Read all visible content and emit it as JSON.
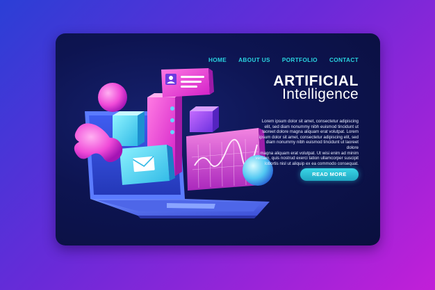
{
  "nav": {
    "items": [
      "HOME",
      "ABOUT US",
      "PORTFOLIO",
      "CONTACT"
    ]
  },
  "hero": {
    "title_line1": "ARTIFICIAL",
    "title_line2": "Intelligence",
    "body_lines": [
      "Lorem ipsum dolor sit amet, consectetur adipiscing",
      "elit, sed diam nonummy nibh euismod tincidunt ut",
      "laoreet dolore magna aliquam erat volutpat. Lorem",
      "ipsum dolor sit amet, consectetur adipiscing elit, sed",
      "diam nonummy nibh euismod tincidunt ut laoreet dolore",
      "magna aliquam erat volutpat. Ut wisi enim ad minim",
      "veniam, quis nostrud exerci tation ullamcorper suscipit",
      "lobortis nisl ut aliquip ex ea commodo consequat."
    ],
    "cta_label": "READ MORE"
  },
  "colors": {
    "accent": "#29d3e0",
    "card_background": "#0d1451",
    "page_gradient_start": "#2b3fd6",
    "page_gradient_end": "#c21fd8"
  },
  "icons": [
    "mail-icon",
    "user-card-icon",
    "line-chart-icon"
  ]
}
